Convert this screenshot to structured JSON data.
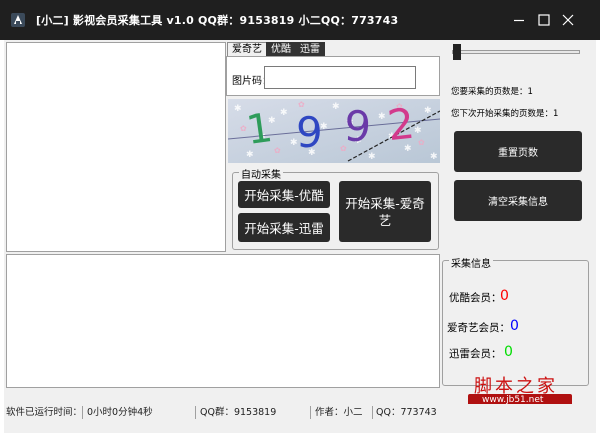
{
  "window": {
    "title": "[小二]  影视会员采集工具  v1.0   QQ群：9153819 小二QQ：773743"
  },
  "tabs": [
    {
      "label": "爱奇艺",
      "active": true
    },
    {
      "label": "优酷",
      "active": false
    },
    {
      "label": "迅雷",
      "active": false
    }
  ],
  "captcha": {
    "label": "图片码：",
    "input_value": "",
    "image_text": "1992"
  },
  "auto_collect": {
    "legend": "自动采集",
    "btn_youku": "开始采集-优酷",
    "btn_xunlei": "开始采集-迅雷",
    "btn_iqiyi": "开始采集-爱奇艺"
  },
  "settings": {
    "slider_value": 1,
    "pages_to_collect": "您要采集的页数是：1",
    "next_start_page": "您下次开始采集的页数是：1",
    "reset_button": "重置页数",
    "clear_button": "清空采集信息"
  },
  "collect_info": {
    "legend": "采集信息",
    "youku_label": "优酷会员：",
    "youku_count": "0",
    "iqiyi_label": "爱奇艺会员：",
    "iqiyi_count": "0",
    "xunlei_label": "迅雷会员：",
    "xunlei_count": "0"
  },
  "statusbar": {
    "runtime_label": "软件已运行时间：",
    "runtime_value": "0小时0分钟4秒",
    "qq_group": "QQ群：9153819",
    "author": "作者：小二",
    "qq": "QQ：773743"
  },
  "watermark": {
    "text": "脚本之家",
    "url": "www.jb51.net"
  },
  "colors": {
    "titlebar": "#1f1f1f",
    "button_dark": "#2a2a2a",
    "youku_count": "#ff0000",
    "iqiyi_count": "#0000ff",
    "xunlei_count": "#00dd00"
  }
}
